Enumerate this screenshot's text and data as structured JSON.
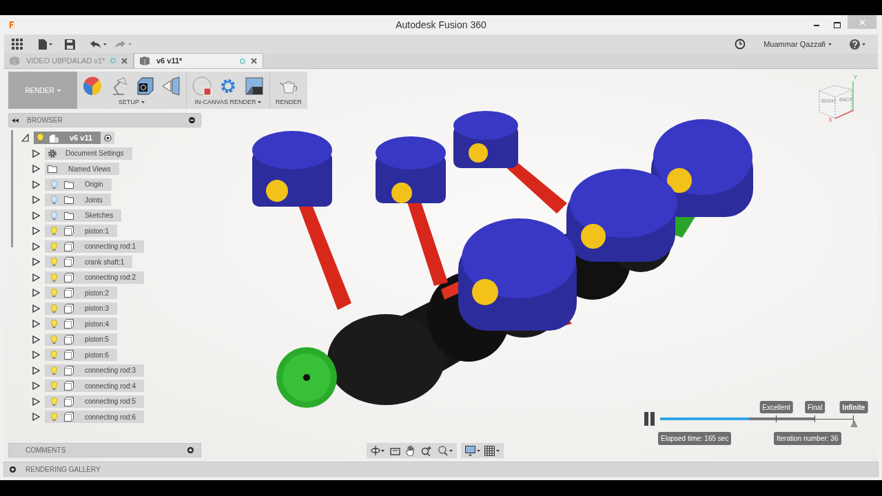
{
  "window": {
    "title": "Autodesk Fusion 360"
  },
  "toolbar": {
    "user": "Muammar Qazzafi"
  },
  "tabs": [
    {
      "label": "VIDEO U8PDALAD v1*",
      "selected": false
    },
    {
      "label": "v6 v11*",
      "selected": true
    }
  ],
  "ribbon": {
    "workspace": "RENDER",
    "groups": [
      {
        "label": "SETUP",
        "kind": "setup"
      },
      {
        "label": "IN-CANVAS RENDER",
        "kind": "incanvas"
      },
      {
        "label": "RENDER",
        "kind": "render"
      }
    ]
  },
  "browser": {
    "title": "BROWSER",
    "tree": [
      {
        "label": "v6 v11",
        "kind": "root",
        "selected": true,
        "visible": true,
        "expanded": true,
        "children": [
          {
            "label": "Document Settings",
            "kind": "settings",
            "expanded": false
          },
          {
            "label": "Named Views",
            "kind": "views",
            "expanded": false
          },
          {
            "label": "Origin",
            "kind": "folder",
            "visible": false,
            "expanded": false
          },
          {
            "label": "Joints",
            "kind": "folder",
            "visible": false,
            "expanded": false
          },
          {
            "label": "Sketches",
            "kind": "folder",
            "visible": false,
            "expanded": false
          },
          {
            "label": "piston:1",
            "kind": "component",
            "visible": true,
            "expanded": false
          },
          {
            "label": "connecting rod:1",
            "kind": "component",
            "visible": true,
            "expanded": false
          },
          {
            "label": "crank shaft:1",
            "kind": "component",
            "visible": true,
            "expanded": false
          },
          {
            "label": "connecting rod:2",
            "kind": "component",
            "visible": true,
            "expanded": false
          },
          {
            "label": "piston:2",
            "kind": "component",
            "visible": true,
            "expanded": false
          },
          {
            "label": "piston:3",
            "kind": "component",
            "visible": true,
            "expanded": false
          },
          {
            "label": "piston:4",
            "kind": "component",
            "visible": true,
            "expanded": false
          },
          {
            "label": "piston:5",
            "kind": "component",
            "visible": true,
            "expanded": false
          },
          {
            "label": "piston:6",
            "kind": "component",
            "visible": true,
            "expanded": false
          },
          {
            "label": "connecting rod:3",
            "kind": "component",
            "visible": true,
            "expanded": false
          },
          {
            "label": "connecting rod:4",
            "kind": "component",
            "visible": true,
            "expanded": false
          },
          {
            "label": "connecting rod:5",
            "kind": "component",
            "visible": true,
            "expanded": false
          },
          {
            "label": "connecting rod:6",
            "kind": "component",
            "visible": true,
            "expanded": false
          }
        ]
      }
    ]
  },
  "view_cube": {
    "faces": [
      "RIGHT",
      "BACK"
    ],
    "axes": [
      "X",
      "Y"
    ]
  },
  "render_progress": {
    "level": 0.46,
    "markers": [
      {
        "label": "Excellent",
        "selected": false
      },
      {
        "label": "Final",
        "selected": false
      },
      {
        "label": "Infinite",
        "selected": true
      }
    ],
    "elapsed": "Elapsed time: 165 sec",
    "iterations": "Iteration number: 36"
  },
  "comments": {
    "title": "COMMENTS"
  },
  "gallery": {
    "title": "RENDERING GALLERY"
  }
}
